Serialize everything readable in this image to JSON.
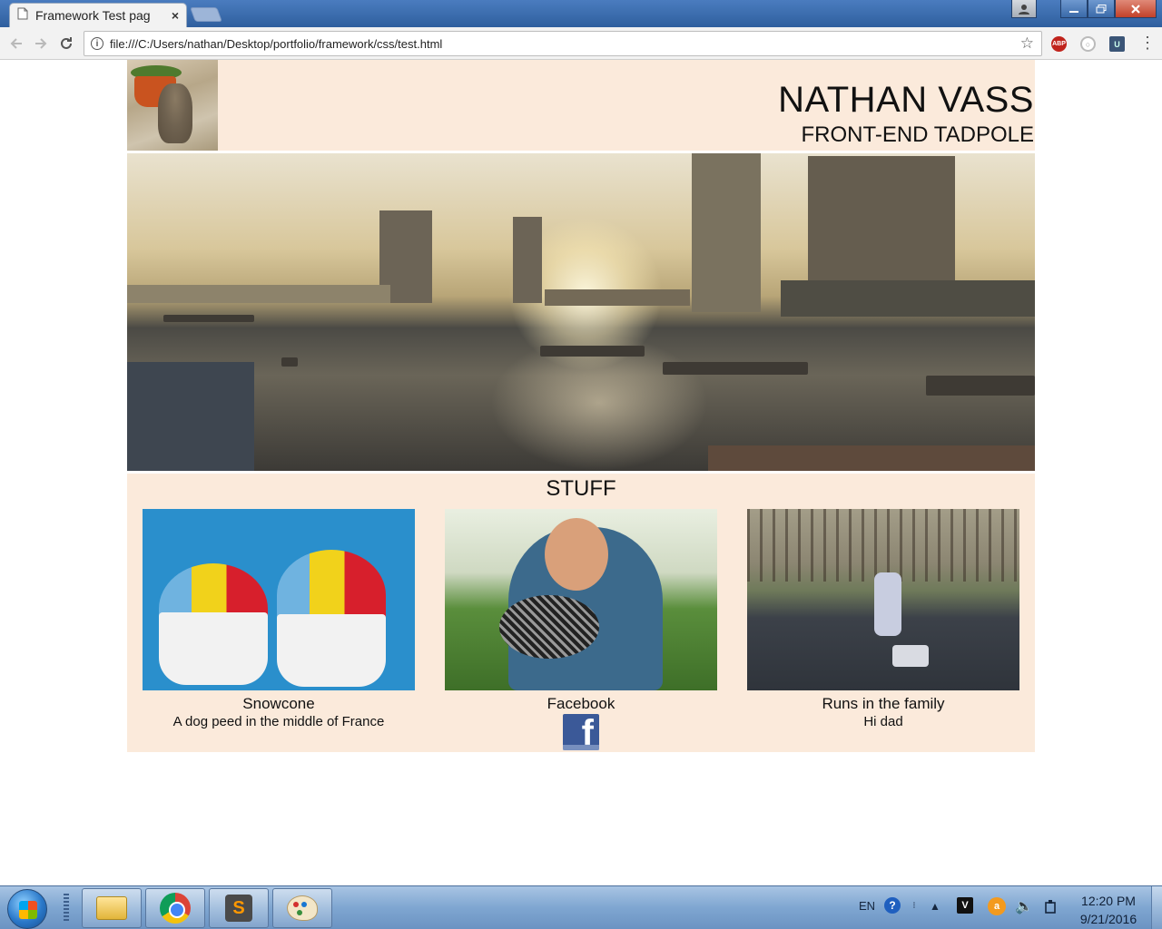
{
  "browser": {
    "tab_title": "Framework Test pag",
    "tab_close": "×",
    "url": "file:///C:/Users/nathan/Desktop/portfolio/framework/css/test.html",
    "extensions": {
      "abp": "ABP"
    }
  },
  "site": {
    "name": "NATHAN VASS",
    "tagline": "FRONT-END TADPOLE"
  },
  "stuff": {
    "title": "STUFF",
    "cards": [
      {
        "caption": "Snowcone",
        "subtitle": "A dog peed in the middle of France"
      },
      {
        "caption": "Facebook",
        "icon": "facebook-icon"
      },
      {
        "caption": "Runs in the family",
        "subtitle": "Hi dad"
      }
    ]
  },
  "taskbar": {
    "apps": [
      "windows-explorer-icon",
      "chrome-icon",
      "sublime-text-icon",
      "paint-icon"
    ],
    "language": "EN",
    "time": "12:20 PM",
    "date": "9/21/2016"
  }
}
